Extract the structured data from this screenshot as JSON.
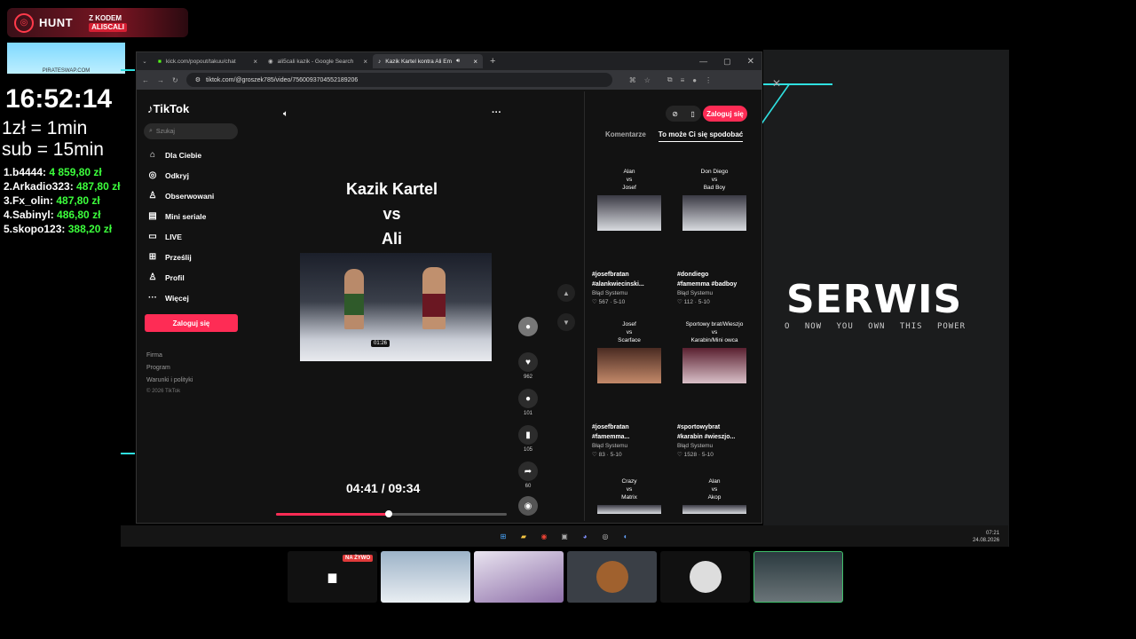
{
  "overlay": {
    "hunt_brand": "HUNT",
    "hunt_code_label": "Z KODEM",
    "hunt_code": "ALISCALI",
    "pirate_caption": "PIRATESWAP.COM",
    "clock": "16:52:14",
    "rate_money": "1zł = 1min",
    "rate_sub": "sub = 15min",
    "leaderboard": [
      {
        "rank_name": "1.b4444:",
        "amount": "4 859,80 zł"
      },
      {
        "rank_name": "2.Arkadio323:",
        "amount": "487,80 zł"
      },
      {
        "rank_name": "3.Fx_olin:",
        "amount": "487,80 zł"
      },
      {
        "rank_name": "4.Sabinyl:",
        "amount": "486,80 zł"
      },
      {
        "rank_name": "5.skopo123:",
        "amount": "388,20 zł"
      }
    ],
    "serwis": "SERWIS",
    "tagline": "O NOW   YOU OWN THIS POWER"
  },
  "browser": {
    "tabs": [
      {
        "label": "kick.com/popout/takuu/chat",
        "icon": "kick-icon"
      },
      {
        "label": "ali5cali kazik - Google Search",
        "icon": "google-icon"
      },
      {
        "label": "Kazik Kartel kontra Ali Em",
        "icon": "tiktok-icon"
      }
    ],
    "url": "tiktok.com/@groszek785/video/7560093704552189206"
  },
  "tiktok": {
    "brand": "TikTok",
    "search_placeholder": "Szukaj",
    "nav": [
      "Dla Ciebie",
      "Odkryj",
      "Obserwowani",
      "Mini seriale",
      "LIVE",
      "Prześlij",
      "Profil",
      "Więcej"
    ],
    "login_button": "Zaloguj się",
    "footer": [
      "Firma",
      "Program",
      "Warunki i polityki",
      "© 2026 TikTok"
    ],
    "video_title": [
      "Kazik Kartel",
      "vs",
      "Ali"
    ],
    "video_time_badge": "01:26",
    "timecode": "04:41 / 09:34",
    "progress": 0.49,
    "actions": {
      "likes": "962",
      "comments": "101",
      "saves": "105",
      "shares": "60"
    },
    "right_tabs": [
      "Komentarze",
      "To może Ci się spodobać"
    ],
    "cards": [
      {
        "names": [
          "Alan",
          "vs",
          "Josef"
        ],
        "tags": [
          "#josefbratan",
          "#alankwiecinski..."
        ],
        "author": "Błąd Systemu",
        "meta": "567 · 5-10"
      },
      {
        "names": [
          "Don Diego",
          "vs",
          "Bad Boy"
        ],
        "tags": [
          "#dondiego",
          "#famemma #badboy"
        ],
        "author": "Błąd Systemu",
        "meta": "112 · 5-10"
      },
      {
        "names": [
          "Josef",
          "vs",
          "Scarface"
        ],
        "tags": [
          "#josefbratan",
          "#famemma..."
        ],
        "author": "Błąd Systemu",
        "meta": "83 · 5-10"
      },
      {
        "names": [
          "Sportowy brat/Wieszjo",
          "vs",
          "Karabin/Mini owca"
        ],
        "tags": [
          "#sportowybrat",
          "#karabin #wieszjo..."
        ],
        "author": "Błąd Systemu",
        "meta": "1528 · 5-10"
      },
      {
        "names": [
          "Crazy",
          "vs",
          "Matrix"
        ],
        "tags": [],
        "author": "",
        "meta": ""
      },
      {
        "names": [
          "Alan",
          "vs",
          "Akop"
        ],
        "tags": [],
        "author": "",
        "meta": ""
      }
    ]
  },
  "taskbar": {
    "time": "07:21",
    "date": "24.08.2026"
  },
  "cams": {
    "live_badge": "NA ŻYWO"
  },
  "colors": {
    "accent": "#fe2c55",
    "cyan": "#2fe0e0",
    "green": "#3cff3c"
  }
}
